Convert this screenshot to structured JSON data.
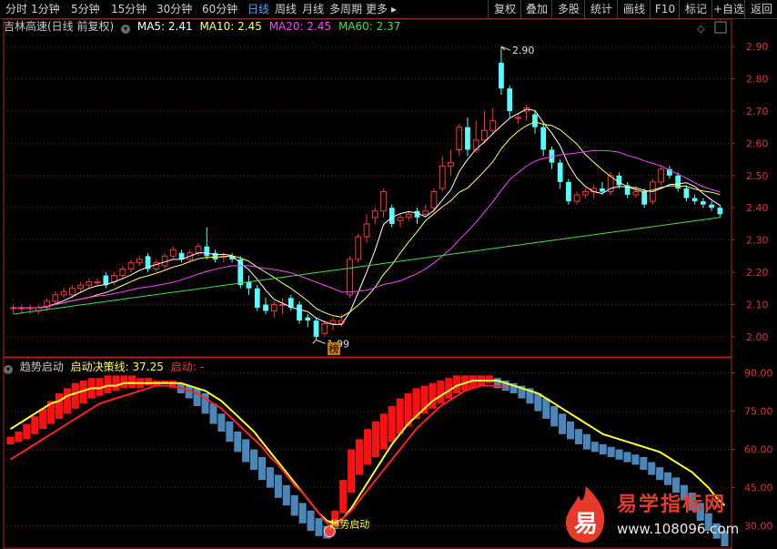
{
  "toolbar": {
    "periods": [
      "分时",
      "1分钟",
      "5分钟",
      "15分钟",
      "30分钟",
      "60分钟",
      "日线",
      "周线",
      "月线",
      "多周期",
      "更多"
    ],
    "active": "日线",
    "right": [
      "复权",
      "叠加",
      "多股",
      "统计",
      "画线",
      "F10",
      "标记",
      "+自选",
      "返回"
    ]
  },
  "main": {
    "title": "吉林高速(日线 前复权)",
    "ma": [
      {
        "label": "MA5: 2.41",
        "color": "#ffffff"
      },
      {
        "label": "MA10: 2.45",
        "color": "#ffff60"
      },
      {
        "label": "MA20: 2.45",
        "color": "#ff40ff"
      },
      {
        "label": "MA60: 2.37",
        "color": "#40e040"
      }
    ],
    "y_ticks": [
      "2.90",
      "2.80",
      "2.70",
      "2.60",
      "2.50",
      "2.40",
      "2.30",
      "2.20",
      "2.10",
      "2.00"
    ],
    "high_label": "2.90",
    "low_label": "1.99",
    "marker": "榜"
  },
  "sub": {
    "title": "趋势启动",
    "line1": "启动决策线: 37.25",
    "line2": "启动: -",
    "line1_color": "#ffff40",
    "line2_color": "#ff3030",
    "y_ticks": [
      "90.00",
      "75.00",
      "60.00",
      "45.00",
      "30.00"
    ],
    "signal": "趋势启动"
  },
  "watermark": {
    "title": "易学指标网",
    "url": "www.108096.com",
    "logo": "易"
  },
  "chart_data": [
    {
      "type": "candlestick",
      "title": "吉林高速(日线 前复权)",
      "ylim": [
        1.96,
        2.94
      ],
      "up_color": "#ff3232",
      "down_color": "#54ffff",
      "candles": [
        [
          2.09,
          2.09,
          2.07,
          2.1
        ],
        [
          2.09,
          2.09,
          2.07,
          2.1
        ],
        [
          2.09,
          2.09,
          2.07,
          2.1
        ],
        [
          2.08,
          2.09,
          2.07,
          2.1
        ],
        [
          2.09,
          2.11,
          2.08,
          2.12
        ],
        [
          2.11,
          2.13,
          2.1,
          2.14
        ],
        [
          2.13,
          2.14,
          2.12,
          2.15
        ],
        [
          2.13,
          2.15,
          2.12,
          2.16
        ],
        [
          2.15,
          2.16,
          2.14,
          2.17
        ],
        [
          2.16,
          2.17,
          2.15,
          2.18
        ],
        [
          2.17,
          2.17,
          2.16,
          2.18
        ],
        [
          2.19,
          2.16,
          2.15,
          2.2
        ],
        [
          2.17,
          2.19,
          2.16,
          2.2
        ],
        [
          2.19,
          2.21,
          2.18,
          2.22
        ],
        [
          2.21,
          2.23,
          2.2,
          2.24
        ],
        [
          2.23,
          2.24,
          2.22,
          2.25
        ],
        [
          2.25,
          2.21,
          2.2,
          2.26
        ],
        [
          2.21,
          2.23,
          2.2,
          2.24
        ],
        [
          2.22,
          2.25,
          2.21,
          2.26
        ],
        [
          2.25,
          2.27,
          2.24,
          2.28
        ],
        [
          2.26,
          2.24,
          2.23,
          2.27
        ],
        [
          2.24,
          2.26,
          2.23,
          2.27
        ],
        [
          2.26,
          2.28,
          2.25,
          2.29
        ],
        [
          2.28,
          2.25,
          2.24,
          2.34
        ],
        [
          2.26,
          2.24,
          2.23,
          2.27
        ],
        [
          2.25,
          2.25,
          2.23,
          2.26
        ],
        [
          2.25,
          2.24,
          2.23,
          2.26
        ],
        [
          2.24,
          2.16,
          2.15,
          2.25
        ],
        [
          2.17,
          2.15,
          2.13,
          2.19
        ],
        [
          2.15,
          2.09,
          2.08,
          2.16
        ],
        [
          2.1,
          2.08,
          2.07,
          2.12
        ],
        [
          2.08,
          2.1,
          2.06,
          2.11
        ],
        [
          2.1,
          2.1,
          2.07,
          2.12
        ],
        [
          2.12,
          2.09,
          2.08,
          2.13
        ],
        [
          2.1,
          2.05,
          2.04,
          2.11
        ],
        [
          2.06,
          2.05,
          2.03,
          2.07
        ],
        [
          2.05,
          2.0,
          1.99,
          2.06
        ],
        [
          2.01,
          2.04,
          2.0,
          2.05
        ],
        [
          2.04,
          2.05,
          2.02,
          2.06
        ],
        [
          2.04,
          2.05,
          2.03,
          2.07
        ],
        [
          2.13,
          2.24,
          2.12,
          2.25
        ],
        [
          2.24,
          2.31,
          2.23,
          2.32
        ],
        [
          2.31,
          2.35,
          2.29,
          2.38
        ],
        [
          2.37,
          2.39,
          2.35,
          2.4
        ],
        [
          2.39,
          2.45,
          2.37,
          2.46
        ],
        [
          2.4,
          2.35,
          2.34,
          2.41
        ],
        [
          2.36,
          2.37,
          2.34,
          2.38
        ],
        [
          2.37,
          2.38,
          2.36,
          2.39
        ],
        [
          2.39,
          2.37,
          2.35,
          2.4
        ],
        [
          2.38,
          2.39,
          2.37,
          2.41
        ],
        [
          2.4,
          2.45,
          2.38,
          2.46
        ],
        [
          2.46,
          2.53,
          2.45,
          2.56
        ],
        [
          2.53,
          2.54,
          2.5,
          2.58
        ],
        [
          2.58,
          2.65,
          2.56,
          2.66
        ],
        [
          2.65,
          2.58,
          2.56,
          2.68
        ],
        [
          2.58,
          2.61,
          2.57,
          2.67
        ],
        [
          2.61,
          2.64,
          2.6,
          2.7
        ],
        [
          2.64,
          2.67,
          2.63,
          2.71
        ],
        [
          2.85,
          2.77,
          2.75,
          2.9
        ],
        [
          2.77,
          2.7,
          2.68,
          2.78
        ],
        [
          2.68,
          2.68,
          2.66,
          2.69
        ],
        [
          2.7,
          2.71,
          2.67,
          2.72
        ],
        [
          2.69,
          2.65,
          2.63,
          2.7
        ],
        [
          2.65,
          2.58,
          2.56,
          2.66
        ],
        [
          2.58,
          2.54,
          2.52,
          2.59
        ],
        [
          2.54,
          2.48,
          2.46,
          2.55
        ],
        [
          2.48,
          2.42,
          2.41,
          2.49
        ],
        [
          2.42,
          2.44,
          2.41,
          2.45
        ],
        [
          2.44,
          2.45,
          2.43,
          2.46
        ],
        [
          2.45,
          2.46,
          2.43,
          2.47
        ],
        [
          2.46,
          2.45,
          2.44,
          2.48
        ],
        [
          2.45,
          2.5,
          2.44,
          2.51
        ],
        [
          2.5,
          2.47,
          2.46,
          2.51
        ],
        [
          2.47,
          2.44,
          2.43,
          2.48
        ],
        [
          2.44,
          2.45,
          2.43,
          2.47
        ],
        [
          2.45,
          2.41,
          2.4,
          2.46
        ],
        [
          2.42,
          2.48,
          2.41,
          2.49
        ],
        [
          2.48,
          2.52,
          2.47,
          2.53
        ],
        [
          2.52,
          2.5,
          2.49,
          2.53
        ],
        [
          2.5,
          2.46,
          2.45,
          2.51
        ],
        [
          2.46,
          2.43,
          2.42,
          2.47
        ],
        [
          2.43,
          2.42,
          2.41,
          2.44
        ],
        [
          2.42,
          2.41,
          2.4,
          2.43
        ],
        [
          2.41,
          2.4,
          2.39,
          2.42
        ],
        [
          2.4,
          2.38,
          2.37,
          2.41
        ]
      ]
    },
    {
      "type": "bar",
      "title": "趋势启动",
      "ylim": [
        22,
        92
      ],
      "bar_colors": {
        "up": "#ff1010",
        "down": "#4a86b8"
      },
      "bars": [
        [
          62,
          65
        ],
        [
          63,
          67
        ],
        [
          64,
          70
        ],
        [
          66,
          73
        ],
        [
          68,
          76
        ],
        [
          70,
          79
        ],
        [
          72,
          82
        ],
        [
          74,
          84
        ],
        [
          76,
          86
        ],
        [
          78,
          87
        ],
        [
          80,
          88
        ],
        [
          81,
          88
        ],
        [
          82,
          89
        ],
        [
          83,
          89
        ],
        [
          84,
          89
        ],
        [
          84,
          89
        ],
        [
          84,
          88
        ],
        [
          85,
          88
        ],
        [
          85,
          87
        ],
        [
          86,
          87
        ],
        [
          84,
          87
        ],
        [
          82,
          86
        ],
        [
          80,
          85
        ],
        [
          77,
          84
        ],
        [
          74,
          82
        ],
        [
          70,
          78
        ],
        [
          67,
          74
        ],
        [
          63,
          71
        ],
        [
          59,
          67
        ],
        [
          55,
          64
        ],
        [
          52,
          60
        ],
        [
          48,
          57
        ],
        [
          45,
          53
        ],
        [
          41,
          50
        ],
        [
          38,
          46
        ],
        [
          34,
          42
        ],
        [
          31,
          39
        ],
        [
          28,
          36
        ],
        [
          26,
          33
        ],
        [
          25,
          30
        ],
        [
          30,
          36
        ],
        [
          35,
          48
        ],
        [
          43,
          60
        ],
        [
          50,
          64
        ],
        [
          54,
          68
        ],
        [
          57,
          71
        ],
        [
          60,
          74
        ],
        [
          63,
          77
        ],
        [
          66,
          80
        ],
        [
          69,
          82
        ],
        [
          72,
          84
        ],
        [
          74,
          85
        ],
        [
          76,
          86
        ],
        [
          78,
          87
        ],
        [
          80,
          88
        ],
        [
          82,
          89
        ],
        [
          83,
          89
        ],
        [
          84,
          89
        ],
        [
          85,
          89
        ],
        [
          86,
          89
        ],
        [
          84,
          88
        ],
        [
          83,
          87
        ],
        [
          82,
          86
        ],
        [
          80,
          85
        ],
        [
          78,
          84
        ],
        [
          75,
          82
        ],
        [
          72,
          80
        ],
        [
          69,
          77
        ],
        [
          66,
          74
        ],
        [
          64,
          71
        ],
        [
          62,
          68
        ],
        [
          60,
          66
        ],
        [
          59,
          63
        ],
        [
          58,
          62
        ],
        [
          57,
          61
        ],
        [
          56,
          60
        ],
        [
          55,
          59
        ],
        [
          54,
          58
        ],
        [
          52,
          57
        ],
        [
          50,
          55
        ],
        [
          48,
          53
        ],
        [
          46,
          51
        ],
        [
          43,
          49
        ],
        [
          40,
          46
        ],
        [
          36,
          43
        ],
        [
          32,
          39
        ],
        [
          28,
          35
        ],
        [
          25,
          31
        ],
        [
          22,
          28
        ]
      ],
      "yellow_line": [
        68,
        70,
        72,
        74,
        76,
        78,
        79,
        81,
        82,
        83,
        84,
        84,
        85,
        85,
        86,
        86,
        86,
        86,
        86,
        86,
        86,
        86,
        85,
        84,
        83,
        81,
        79,
        76,
        73,
        70,
        67,
        63,
        59,
        55,
        51,
        47,
        43,
        39,
        35,
        32,
        31,
        33,
        37,
        42,
        47,
        52,
        57,
        62,
        66,
        70,
        73,
        76,
        79,
        81,
        83,
        85,
        86,
        87,
        87,
        87,
        87,
        86,
        85,
        84,
        83,
        82,
        80,
        78,
        76,
        74,
        72,
        70,
        68,
        66,
        65,
        64,
        63,
        62,
        61,
        60,
        59,
        57,
        55,
        53,
        51,
        48,
        45,
        41,
        38
      ],
      "red_line": [
        56,
        58,
        60,
        62,
        64,
        66,
        68,
        70,
        72,
        74,
        76,
        78,
        79,
        80,
        81,
        82,
        83,
        84,
        85,
        85,
        85,
        84,
        83,
        82,
        80,
        78,
        76,
        73,
        70,
        67,
        64,
        61,
        57,
        54,
        50,
        46,
        43,
        39,
        35,
        31,
        30,
        33,
        36,
        40,
        44,
        48,
        52,
        56,
        60,
        64,
        68,
        71,
        74,
        77,
        79,
        81,
        83,
        84,
        85,
        85,
        85,
        84
      ]
    }
  ]
}
